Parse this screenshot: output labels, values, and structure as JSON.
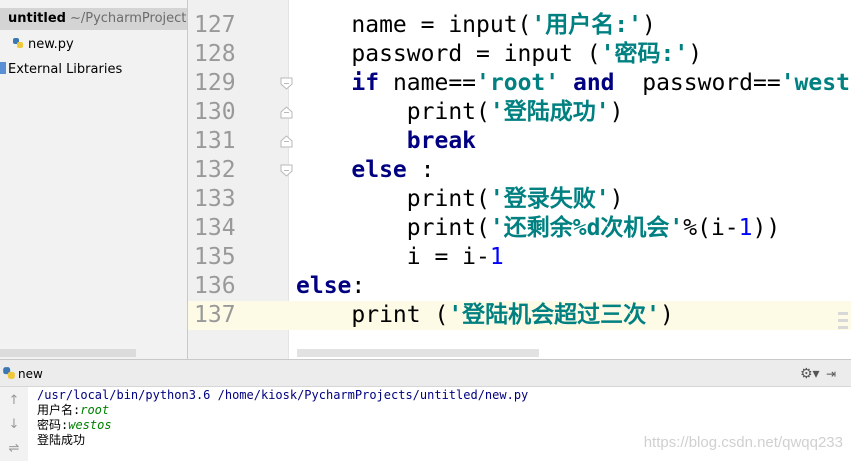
{
  "project": {
    "root_name": "untitled",
    "root_path": "~/PycharmProjects",
    "file": "new.py",
    "external_libraries": "External Libraries"
  },
  "editor": {
    "lines": [
      {
        "num": "127",
        "tokens": [
          [
            "",
            "    name = input("
          ],
          [
            "str",
            "'用户名:'"
          ],
          [
            "",
            ")"
          ]
        ]
      },
      {
        "num": "128",
        "tokens": [
          [
            "",
            "    password = input ("
          ],
          [
            "str",
            "'密码:'"
          ],
          [
            "",
            ")"
          ]
        ]
      },
      {
        "num": "129",
        "tokens": [
          [
            "",
            "    "
          ],
          [
            "kw",
            "if"
          ],
          [
            "",
            " name=="
          ],
          [
            "str",
            "'root'"
          ],
          [
            "",
            " "
          ],
          [
            "kw",
            "and"
          ],
          [
            "",
            "  password=="
          ],
          [
            "str",
            "'west"
          ]
        ]
      },
      {
        "num": "130",
        "tokens": [
          [
            "",
            "        print("
          ],
          [
            "str",
            "'登陆成功'"
          ],
          [
            "",
            ")"
          ]
        ]
      },
      {
        "num": "131",
        "tokens": [
          [
            "",
            "        "
          ],
          [
            "kw",
            "break"
          ]
        ]
      },
      {
        "num": "132",
        "tokens": [
          [
            "",
            "    "
          ],
          [
            "kw",
            "else"
          ],
          [
            "",
            " :"
          ]
        ]
      },
      {
        "num": "133",
        "tokens": [
          [
            "",
            "        print("
          ],
          [
            "str",
            "'登录失败'"
          ],
          [
            "",
            ")"
          ]
        ]
      },
      {
        "num": "134",
        "tokens": [
          [
            "",
            "        print("
          ],
          [
            "str",
            "'还剩余%d次机会'"
          ],
          [
            "",
            "%(i-"
          ],
          [
            "num",
            "1"
          ],
          [
            "",
            "))"
          ]
        ]
      },
      {
        "num": "135",
        "tokens": [
          [
            "",
            "        i = i-"
          ],
          [
            "num",
            "1"
          ]
        ]
      },
      {
        "num": "136",
        "tokens": [
          [
            "kw",
            "else"
          ],
          [
            "",
            ":"
          ]
        ]
      },
      {
        "num": "137",
        "tokens": [
          [
            "",
            "    print ("
          ],
          [
            "str",
            "'登陆机会超过三次'"
          ],
          [
            "",
            ")"
          ]
        ]
      }
    ],
    "current_line": "137"
  },
  "run": {
    "title": "new",
    "command": "/usr/local/bin/python3.6 /home/kiosk/PycharmProjects/untitled/new.py",
    "prompt_user": "用户名:",
    "input_user": "root",
    "prompt_pass": "密码:",
    "input_pass": "westos",
    "result": "登陆成功"
  },
  "watermark": "https://blog.csdn.net/qwqq233",
  "icons": {
    "run": "python-run-icon",
    "settings": "gear-icon",
    "hide": "hide-panel-icon",
    "up": "arrow-up-icon",
    "down": "arrow-down-icon",
    "wrap": "soft-wrap-icon"
  },
  "colors": {
    "keyword": "#000080",
    "string": "#008080",
    "number": "#0000ff",
    "user_input": "#008000",
    "current_line": "#fdfbe6"
  }
}
